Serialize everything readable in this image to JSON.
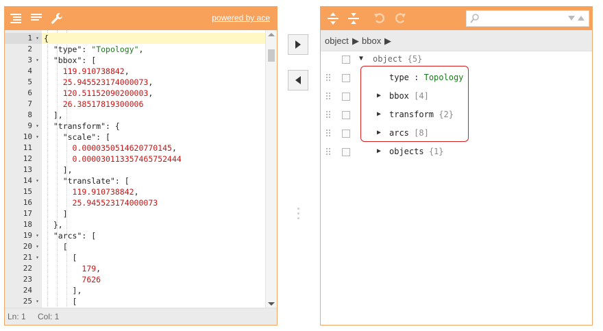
{
  "left_toolbar": {
    "powered_by": "powered by ace"
  },
  "editor": {
    "active_line": 1,
    "lines": [
      {
        "num": "1",
        "fold": true,
        "tokens": [
          {
            "t": "{",
            "c": "p"
          }
        ]
      },
      {
        "num": "2",
        "fold": false,
        "tokens": [
          {
            "t": "  ",
            "c": "p"
          },
          {
            "t": "\"type\"",
            "c": "k"
          },
          {
            "t": ": ",
            "c": "p"
          },
          {
            "t": "\"Topology\"",
            "c": "s"
          },
          {
            "t": ",",
            "c": "p"
          }
        ]
      },
      {
        "num": "3",
        "fold": true,
        "tokens": [
          {
            "t": "  ",
            "c": "p"
          },
          {
            "t": "\"bbox\"",
            "c": "k"
          },
          {
            "t": ": [",
            "c": "p"
          }
        ]
      },
      {
        "num": "4",
        "fold": false,
        "tokens": [
          {
            "t": "    ",
            "c": "p"
          },
          {
            "t": "119.910738842",
            "c": "n"
          },
          {
            "t": ",",
            "c": "p"
          }
        ]
      },
      {
        "num": "5",
        "fold": false,
        "tokens": [
          {
            "t": "    ",
            "c": "p"
          },
          {
            "t": "25.945523174000073",
            "c": "n"
          },
          {
            "t": ",",
            "c": "p"
          }
        ]
      },
      {
        "num": "6",
        "fold": false,
        "tokens": [
          {
            "t": "    ",
            "c": "p"
          },
          {
            "t": "120.51152090200003",
            "c": "n"
          },
          {
            "t": ",",
            "c": "p"
          }
        ]
      },
      {
        "num": "7",
        "fold": false,
        "tokens": [
          {
            "t": "    ",
            "c": "p"
          },
          {
            "t": "26.38517819300006",
            "c": "n"
          }
        ]
      },
      {
        "num": "8",
        "fold": false,
        "tokens": [
          {
            "t": "  ],",
            "c": "p"
          }
        ]
      },
      {
        "num": "9",
        "fold": true,
        "tokens": [
          {
            "t": "  ",
            "c": "p"
          },
          {
            "t": "\"transform\"",
            "c": "k"
          },
          {
            "t": ": {",
            "c": "p"
          }
        ]
      },
      {
        "num": "10",
        "fold": true,
        "tokens": [
          {
            "t": "    ",
            "c": "p"
          },
          {
            "t": "\"scale\"",
            "c": "k"
          },
          {
            "t": ": [",
            "c": "p"
          }
        ]
      },
      {
        "num": "11",
        "fold": false,
        "tokens": [
          {
            "t": "      ",
            "c": "p"
          },
          {
            "t": "0.0000350514620770145",
            "c": "n"
          },
          {
            "t": ",",
            "c": "p"
          }
        ]
      },
      {
        "num": "12",
        "fold": false,
        "tokens": [
          {
            "t": "      ",
            "c": "p"
          },
          {
            "t": "0.000030113357465752444",
            "c": "n"
          }
        ]
      },
      {
        "num": "13",
        "fold": false,
        "tokens": [
          {
            "t": "    ],",
            "c": "p"
          }
        ]
      },
      {
        "num": "14",
        "fold": true,
        "tokens": [
          {
            "t": "    ",
            "c": "p"
          },
          {
            "t": "\"translate\"",
            "c": "k"
          },
          {
            "t": ": [",
            "c": "p"
          }
        ]
      },
      {
        "num": "15",
        "fold": false,
        "tokens": [
          {
            "t": "      ",
            "c": "p"
          },
          {
            "t": "119.910738842",
            "c": "n"
          },
          {
            "t": ",",
            "c": "p"
          }
        ]
      },
      {
        "num": "16",
        "fold": false,
        "tokens": [
          {
            "t": "      ",
            "c": "p"
          },
          {
            "t": "25.945523174000073",
            "c": "n"
          }
        ]
      },
      {
        "num": "17",
        "fold": false,
        "tokens": [
          {
            "t": "    ]",
            "c": "p"
          }
        ]
      },
      {
        "num": "18",
        "fold": false,
        "tokens": [
          {
            "t": "  },",
            "c": "p"
          }
        ]
      },
      {
        "num": "19",
        "fold": true,
        "tokens": [
          {
            "t": "  ",
            "c": "p"
          },
          {
            "t": "\"arcs\"",
            "c": "k"
          },
          {
            "t": ": [",
            "c": "p"
          }
        ]
      },
      {
        "num": "20",
        "fold": true,
        "tokens": [
          {
            "t": "    [",
            "c": "p"
          }
        ]
      },
      {
        "num": "21",
        "fold": true,
        "tokens": [
          {
            "t": "      [",
            "c": "p"
          }
        ]
      },
      {
        "num": "22",
        "fold": false,
        "tokens": [
          {
            "t": "        ",
            "c": "p"
          },
          {
            "t": "179",
            "c": "n"
          },
          {
            "t": ",",
            "c": "p"
          }
        ]
      },
      {
        "num": "23",
        "fold": false,
        "tokens": [
          {
            "t": "        ",
            "c": "p"
          },
          {
            "t": "7626",
            "c": "n"
          }
        ]
      },
      {
        "num": "24",
        "fold": false,
        "tokens": [
          {
            "t": "      ],",
            "c": "p"
          }
        ]
      },
      {
        "num": "25",
        "fold": true,
        "tokens": [
          {
            "t": "      [",
            "c": "p"
          }
        ]
      }
    ]
  },
  "statusbar": {
    "line": "Ln: 1",
    "col": "Col: 1"
  },
  "navbar": {
    "crumbs": [
      "object",
      "bbox"
    ]
  },
  "tree": {
    "root": {
      "label": "object",
      "count": "{5}"
    },
    "items": [
      {
        "field": "type",
        "sep": " : ",
        "value": "Topology",
        "expandable": false
      },
      {
        "field": "bbox",
        "count": "[4]",
        "expandable": true
      },
      {
        "field": "transform",
        "count": "{2}",
        "expandable": true
      },
      {
        "field": "arcs",
        "count": "[8]",
        "expandable": true
      },
      {
        "field": "objects",
        "count": "{1}",
        "expandable": true
      }
    ]
  },
  "colors": {
    "toolbar": "#f7a15b",
    "border": "#f0a868",
    "highlight": "#d61f1f"
  }
}
